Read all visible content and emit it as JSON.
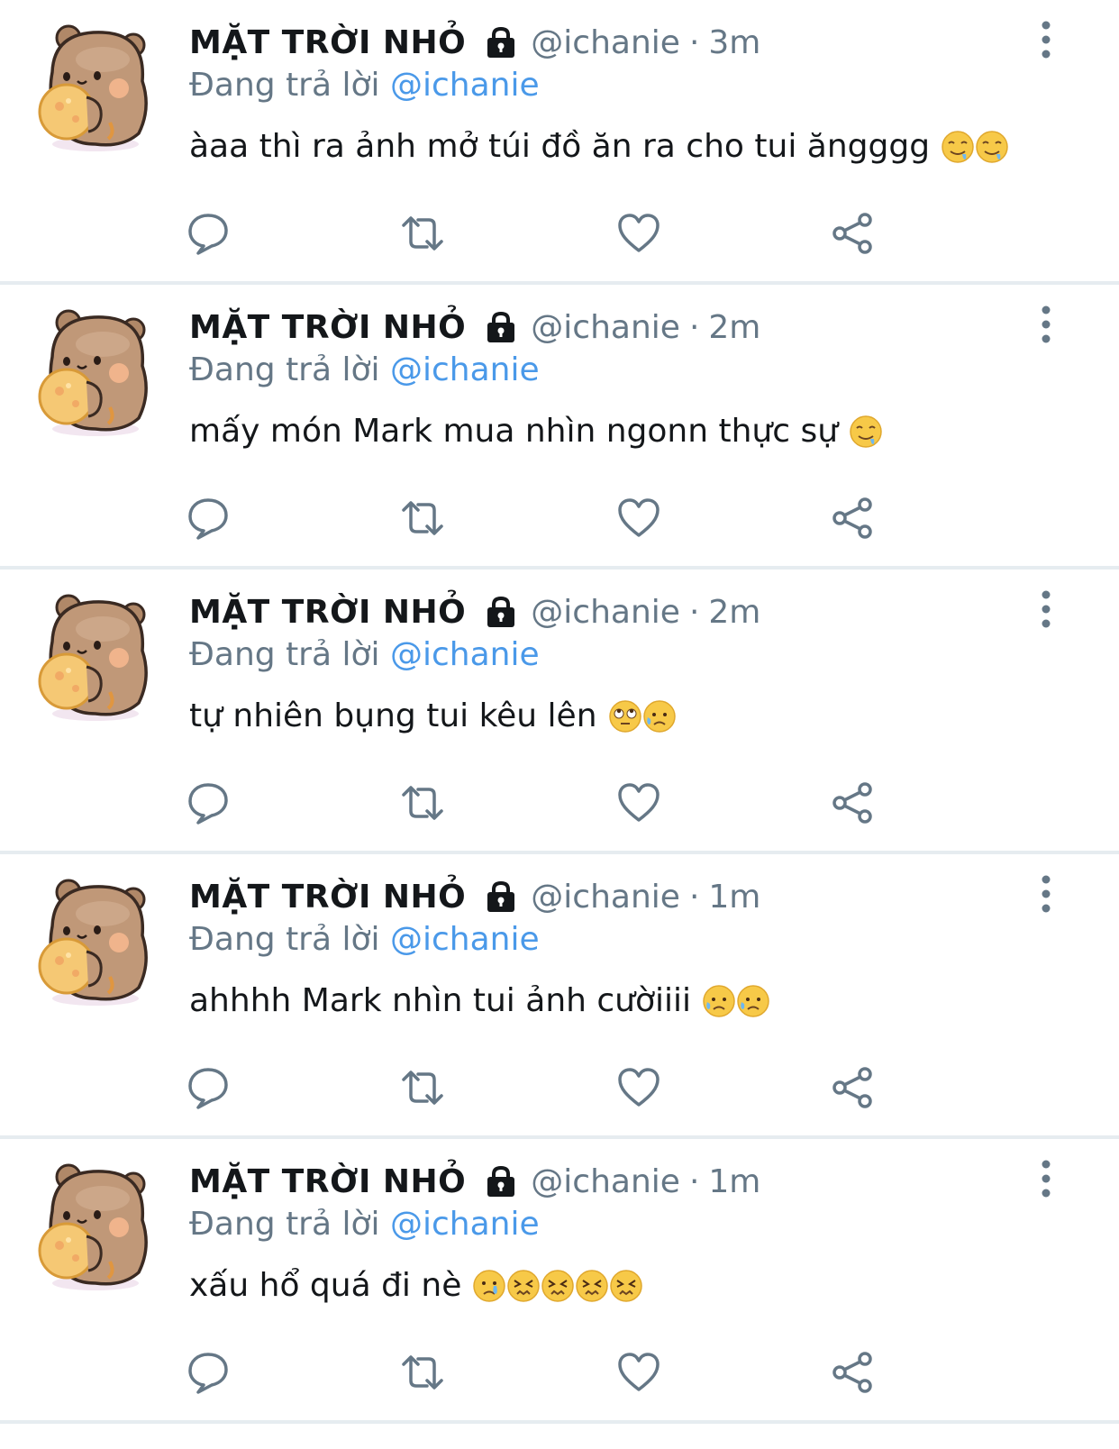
{
  "colors": {
    "name": "#14171a",
    "muted": "#657786",
    "mention": "#4a99e9",
    "divider": "#e6ecf0"
  },
  "icons": [
    "avatar-bear",
    "lock-icon",
    "more-icon",
    "reply-icon",
    "retweet-icon",
    "like-icon",
    "share-icon"
  ],
  "tweets": [
    {
      "name": "MẶT TRỜI NHỎ",
      "handle": "@ichanie",
      "sep": "·",
      "time": "3m",
      "reply_prefix": "Đang trả lời",
      "reply_to": "@ichanie",
      "text": "àaa thì ra ảnh mở túi đồ ăn ra cho tui ăngggg",
      "emojis": [
        "drooling-face",
        "drooling-face"
      ]
    },
    {
      "name": "MẶT TRỜI NHỎ",
      "handle": "@ichanie",
      "sep": "·",
      "time": "2m",
      "reply_prefix": "Đang trả lời",
      "reply_to": "@ichanie",
      "text": "mấy món Mark mua nhìn ngonn thực sự",
      "emojis": [
        "drooling-face"
      ]
    },
    {
      "name": "MẶT TRỜI NHỎ",
      "handle": "@ichanie",
      "sep": "·",
      "time": "2m",
      "reply_prefix": "Đang trả lời",
      "reply_to": "@ichanie",
      "text": "tự nhiên bụng tui kêu lên",
      "emojis": [
        "rolling-eyes-face",
        "sad-sweat-face"
      ]
    },
    {
      "name": "MẶT TRỜI NHỎ",
      "handle": "@ichanie",
      "sep": "·",
      "time": "1m",
      "reply_prefix": "Đang trả lời",
      "reply_to": "@ichanie",
      "text": "ahhhh Mark nhìn tui ảnh cườiiii",
      "emojis": [
        "sad-sweat-face",
        "sad-sweat-face"
      ]
    },
    {
      "name": "MẶT TRỜI NHỎ",
      "handle": "@ichanie",
      "sep": "·",
      "time": "1m",
      "reply_prefix": "Đang trả lời",
      "reply_to": "@ichanie",
      "text": "xấu hổ quá đi nè",
      "emojis": [
        "crying-face",
        "confounded-face",
        "confounded-face",
        "confounded-face",
        "confounded-face"
      ]
    }
  ]
}
